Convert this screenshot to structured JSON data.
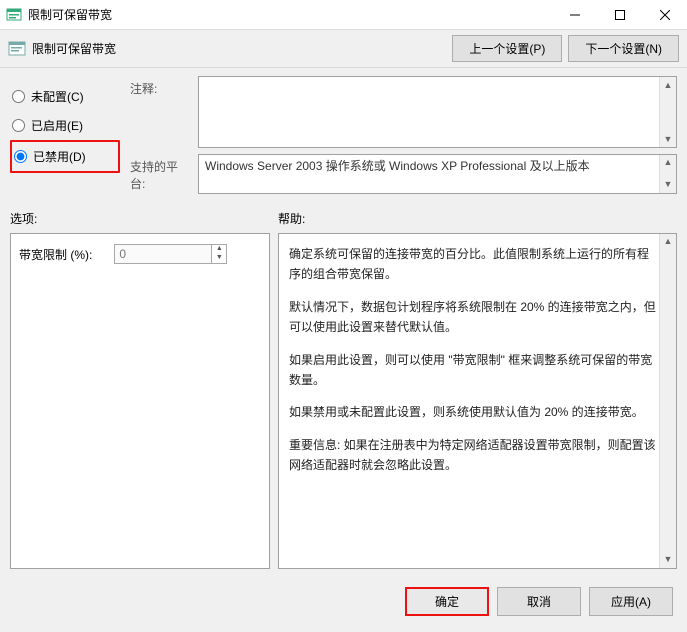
{
  "window": {
    "title": "限制可保留带宽"
  },
  "toolbar": {
    "title": "限制可保留带宽",
    "prev_btn": "上一个设置(P)",
    "next_btn": "下一个设置(N)"
  },
  "radios": {
    "not_configured": "未配置(C)",
    "enabled": "已启用(E)",
    "disabled": "已禁用(D)",
    "selected": "disabled"
  },
  "labels": {
    "comment": "注释:",
    "platform": "支持的平台:",
    "options": "选项:",
    "help": "帮助:",
    "bandwidth_limit": "带宽限制 (%):"
  },
  "platform_text": "Windows Server 2003 操作系统或 Windows XP Professional 及以上版本",
  "options": {
    "bandwidth_value": "0"
  },
  "help": {
    "p1": "确定系统可保留的连接带宽的百分比。此值限制系统上运行的所有程序的组合带宽保留。",
    "p2": "默认情况下，数据包计划程序将系统限制在 20% 的连接带宽之内，但可以使用此设置来替代默认值。",
    "p3": "如果启用此设置，则可以使用 \"带宽限制\" 框来调整系统可保留的带宽数量。",
    "p4": "如果禁用或未配置此设置，则系统使用默认值为 20% 的连接带宽。",
    "p5": "重要信息: 如果在注册表中为特定网络适配器设置带宽限制，则配置该网络适配器时就会忽略此设置。"
  },
  "footer": {
    "ok": "确定",
    "cancel": "取消",
    "apply": "应用(A)"
  }
}
